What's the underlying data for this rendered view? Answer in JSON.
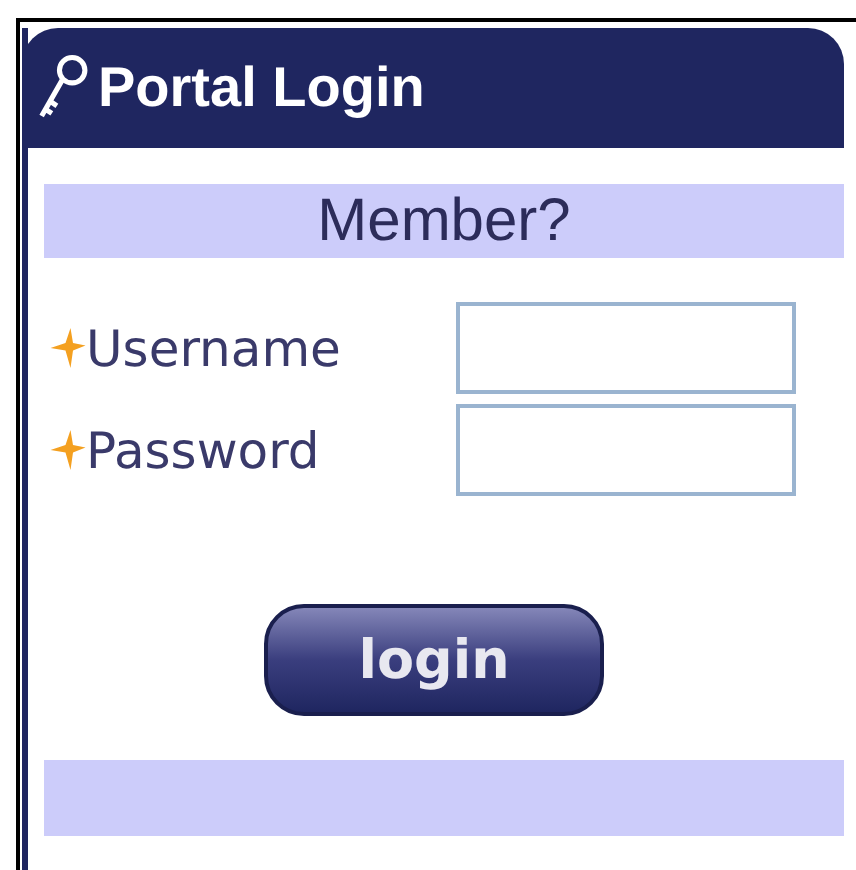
{
  "panel": {
    "title": "Portal Login"
  },
  "banner": "Member?",
  "fields": [
    {
      "label": "Username",
      "required": true
    },
    {
      "label": "Password",
      "required": true
    }
  ],
  "button": "login"
}
